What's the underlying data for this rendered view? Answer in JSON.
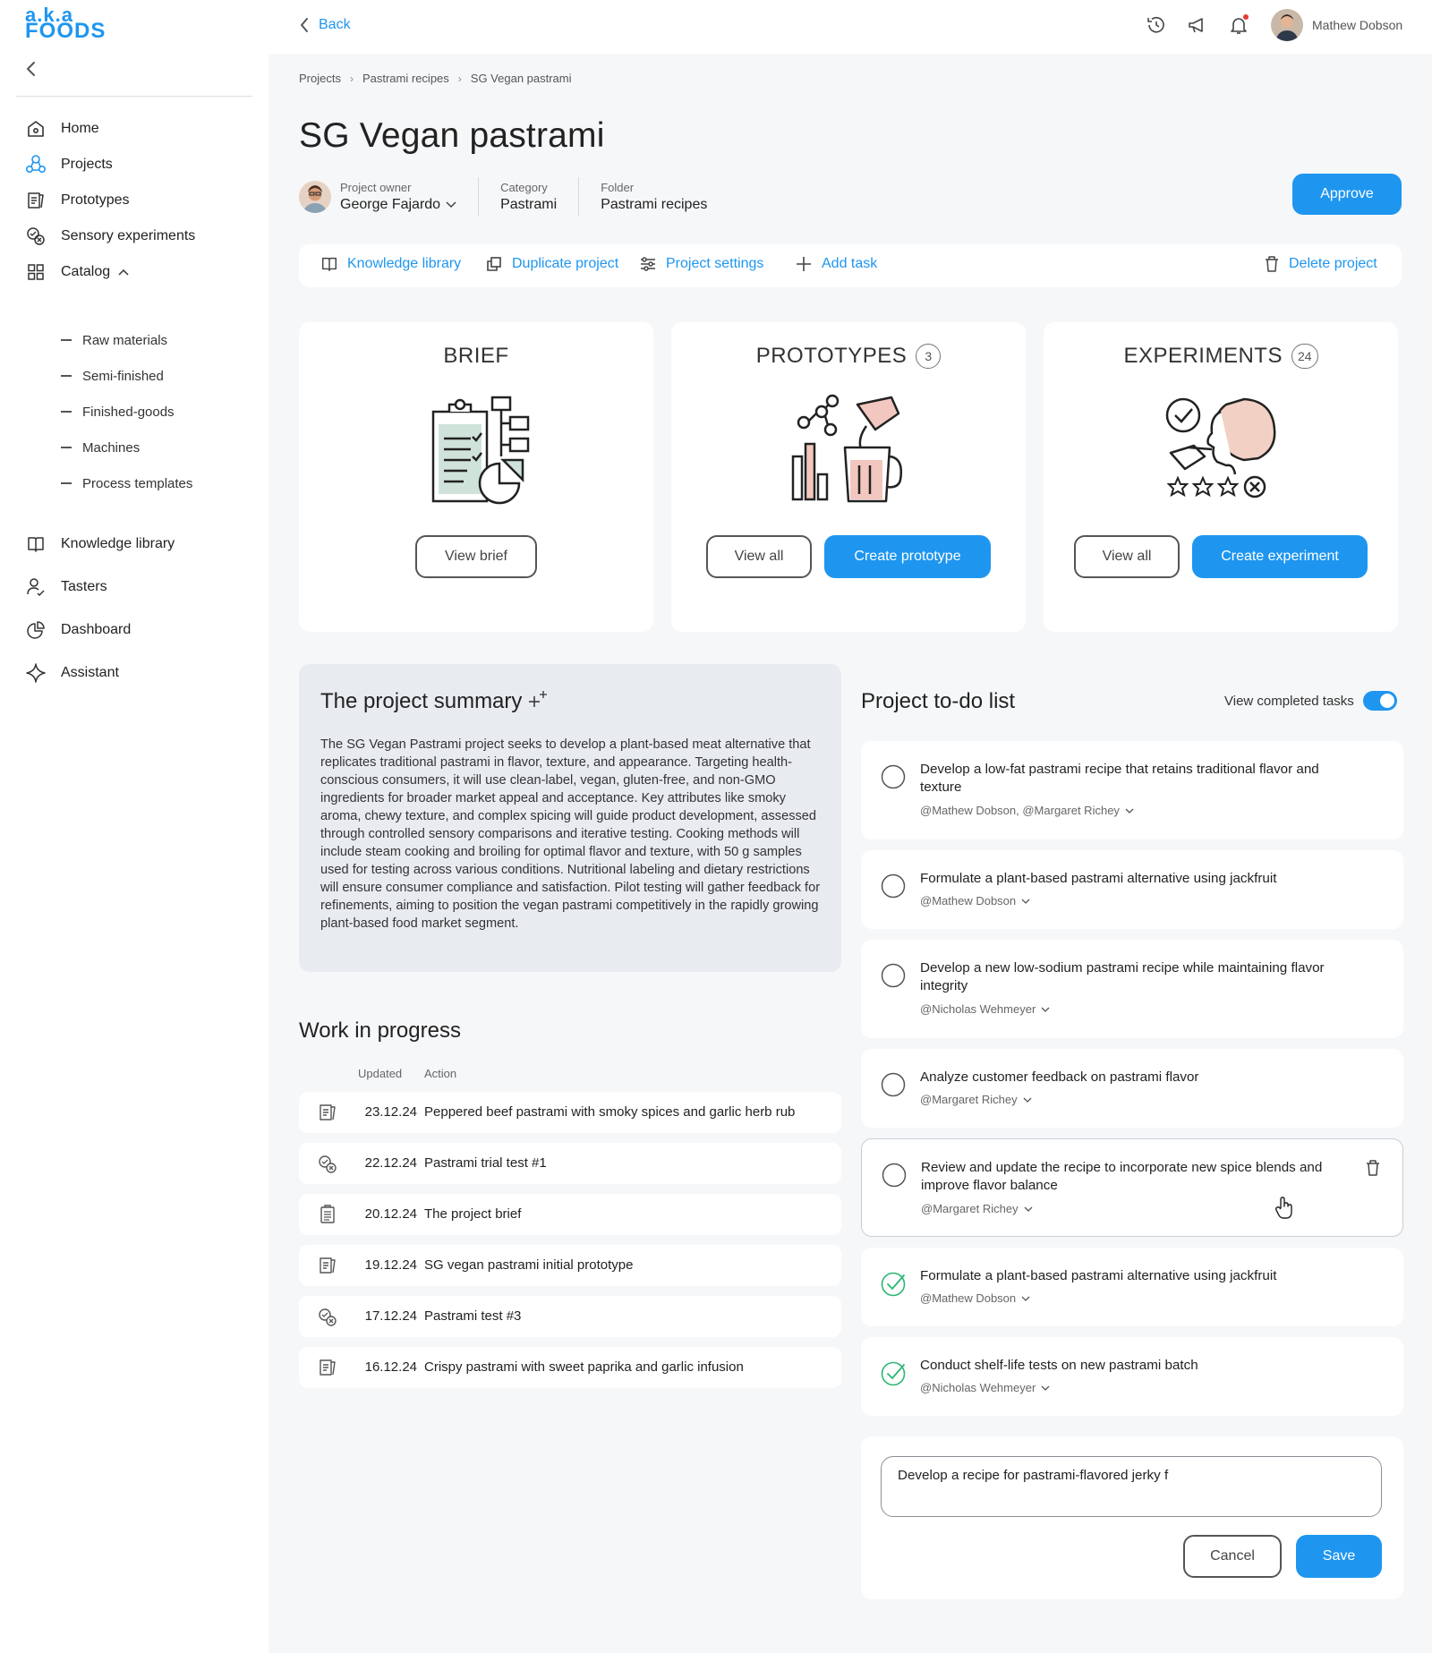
{
  "brand": {
    "line1": "a.k.a",
    "line2": "FOODS",
    "color": "#1e96f0"
  },
  "sidebar": {
    "items": [
      {
        "label": "Home",
        "icon": "home-icon"
      },
      {
        "label": "Projects",
        "icon": "projects-icon",
        "active": true
      },
      {
        "label": "Prototypes",
        "icon": "prototypes-icon"
      },
      {
        "label": "Sensory experiments",
        "icon": "sensory-icon"
      },
      {
        "label": "Catalog",
        "icon": "catalog-icon",
        "expanded": true
      }
    ],
    "catalog_children": [
      "Raw materials",
      "Semi-finished",
      "Finished-goods",
      "Machines",
      "Process templates"
    ],
    "items2": [
      {
        "label": "Knowledge library",
        "icon": "book-icon"
      },
      {
        "label": "Tasters",
        "icon": "tasters-icon"
      },
      {
        "label": "Dashboard",
        "icon": "dashboard-icon"
      },
      {
        "label": "Assistant",
        "icon": "sparkle-icon"
      }
    ]
  },
  "topbar": {
    "back_label": "Back",
    "user_name": "Mathew Dobson"
  },
  "breadcrumb": [
    "Projects",
    "Pastrami recipes",
    "SG Vegan pastrami"
  ],
  "page_title": "SG Vegan pastrami",
  "meta": {
    "owner_label": "Project owner",
    "owner_value": "George Fajardo",
    "category_label": "Category",
    "category_value": "Pastrami",
    "folder_label": "Folder",
    "folder_value": "Pastrami recipes"
  },
  "approve_label": "Approve",
  "toolbar": {
    "knowledge": "Knowledge library",
    "duplicate": "Duplicate project",
    "settings": "Project settings",
    "add_task": "Add task",
    "delete": "Delete project"
  },
  "cards": {
    "brief": {
      "title": "BRIEF",
      "btn": "View brief"
    },
    "prototypes": {
      "title": "PROTOTYPES",
      "count": "3",
      "btn_view": "View all",
      "btn_create": "Create prototype"
    },
    "experiments": {
      "title": "EXPERIMENTS",
      "count": "24",
      "btn_view": "View all",
      "btn_create": "Create experiment"
    }
  },
  "summary": {
    "title": "The project summary",
    "text": "The SG Vegan Pastrami project seeks to develop a plant-based meat alternative that replicates traditional pastrami in flavor, texture, and appearance. Targeting health-conscious consumers, it will use clean-label, vegan, gluten-free, and non-GMO ingredients for broader market appeal and acceptance. Key attributes like smoky aroma, chewy texture, and complex spicing will guide product development, assessed through controlled sensory comparisons and iterative testing. Cooking methods will include steam cooking and broiling for optimal flavor and texture, with 50 g samples used for testing across various conditions. Nutritional labeling and dietary restrictions will ensure consumer compliance and satisfaction. Pilot testing will gather feedback for refinements, aiming to position the vegan pastrami competitively in the rapidly growing plant-based food market segment."
  },
  "wip": {
    "title": "Work in progress",
    "col_updated": "Updated",
    "col_action": "Action",
    "rows": [
      {
        "date": "23.12.24",
        "action": "Peppered beef pastrami with smoky spices and garlic herb rub",
        "icon": "prototype-icon"
      },
      {
        "date": "22.12.24",
        "action": "Pastrami trial test #1",
        "icon": "experiment-icon"
      },
      {
        "date": "20.12.24",
        "action": "The project brief",
        "icon": "brief-icon"
      },
      {
        "date": "19.12.24",
        "action": "SG vegan pastrami initial prototype",
        "icon": "prototype-icon"
      },
      {
        "date": "17.12.24",
        "action": "Pastrami test #3",
        "icon": "experiment-icon"
      },
      {
        "date": "16.12.24",
        "action": "Crispy pastrami with sweet paprika and garlic infusion",
        "icon": "prototype-icon"
      }
    ]
  },
  "todo": {
    "title": "Project to-do list",
    "toggle_label": "View completed tasks",
    "toggle_on": true,
    "tasks": [
      {
        "text": "Develop a low-fat pastrami recipe that retains traditional flavor and texture",
        "assignees": "@Mathew Dobson, @Margaret Richey",
        "done": false
      },
      {
        "text": "Formulate a plant-based pastrami alternative using jackfruit",
        "assignees": "@Mathew Dobson",
        "done": false
      },
      {
        "text": "Develop a new low-sodium pastrami recipe while maintaining flavor integrity",
        "assignees": "@Nicholas Wehmeyer",
        "done": false
      },
      {
        "text": "Analyze customer feedback on pastrami flavor",
        "assignees": "@Margaret Richey",
        "done": false
      },
      {
        "text": "Review and update the recipe to incorporate new spice blends and improve flavor balance",
        "assignees": "@Margaret Richey",
        "done": false,
        "hovered": true
      },
      {
        "text": "Formulate a plant-based pastrami alternative using jackfruit",
        "assignees": "@Mathew Dobson",
        "done": true
      },
      {
        "text": "Conduct shelf-life tests on new pastrami batch",
        "assignees": "@Nicholas Wehmeyer",
        "done": true
      }
    ],
    "new_task_value": "Develop a recipe for pastrami-flavored jerky f",
    "cancel_label": "Cancel",
    "save_label": "Save"
  },
  "colors": {
    "accent": "#1e96f0",
    "done_green": "#2bb673",
    "illustration_pink": "#f2c7bf",
    "illustration_mint": "#cfe3da",
    "notification": "#e53935"
  }
}
